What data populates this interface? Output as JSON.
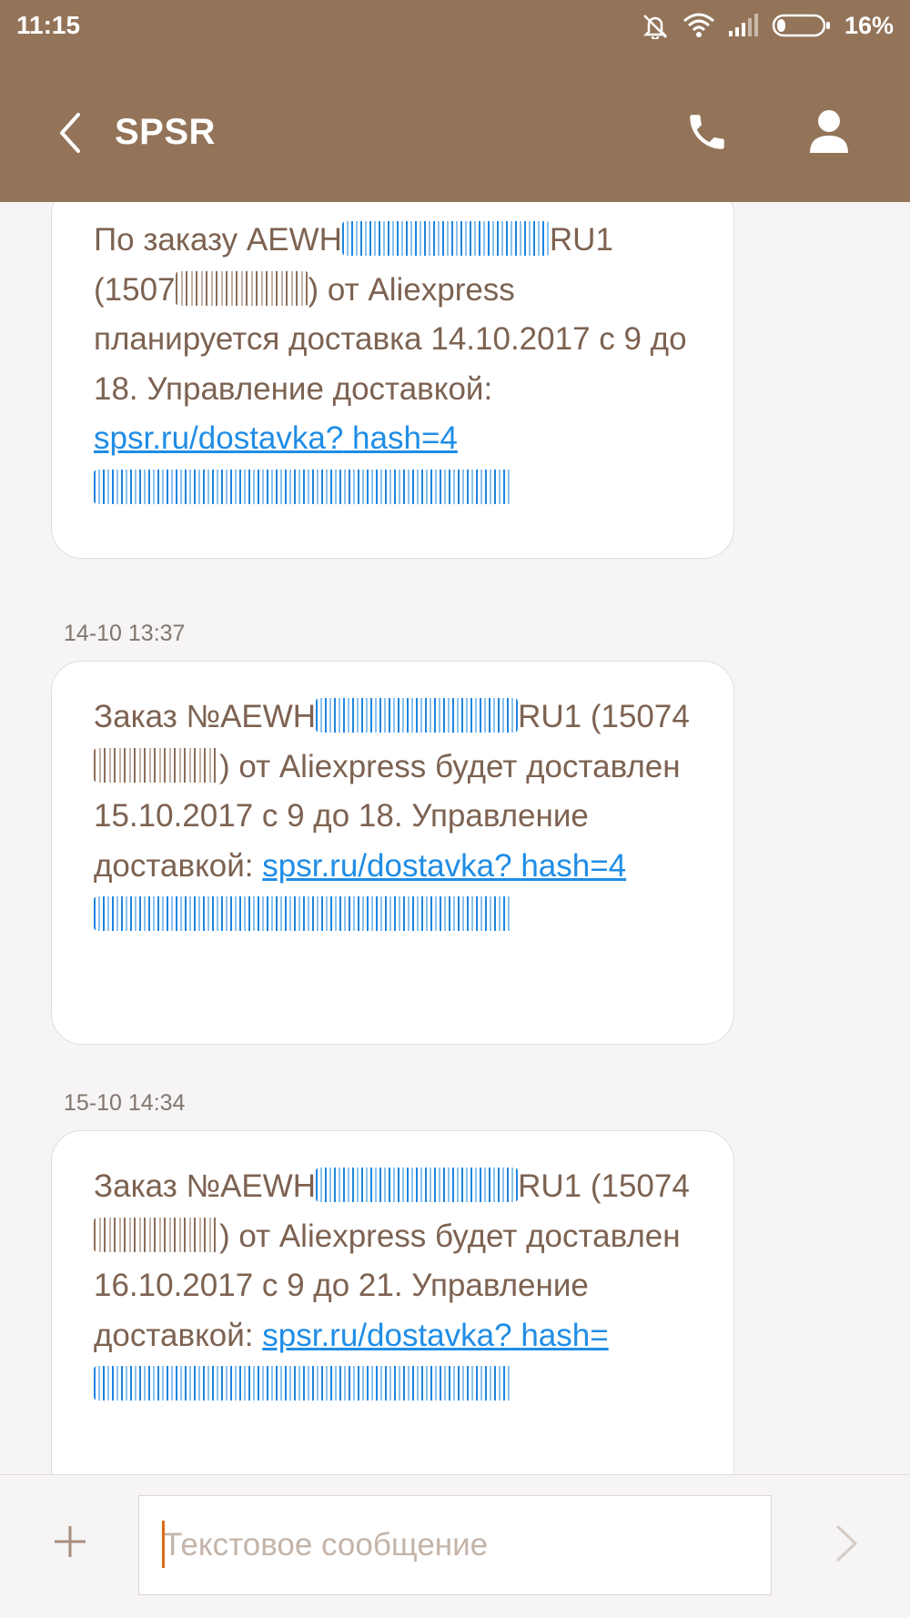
{
  "status": {
    "time": "11:15",
    "battery": "16%"
  },
  "header": {
    "title": "SPSR"
  },
  "messages": [
    {
      "timestamp": "",
      "text_a": "По заказу AEWH",
      "text_b": "RU1",
      "text_c": "(1507",
      "text_d": ") от Aliexpress планируется доставка 14.10.2017 с 9 до 18. Управление доставкой: ",
      "link_a": "spsr.ru/dostavka?",
      "link_b": "hash=4"
    },
    {
      "timestamp": "14-10 13:37",
      "text_a": "Заказ №AEWH",
      "text_b": "RU1",
      "text_c": "(15074",
      "text_d": ") от Aliexpress будет доставлен 15.10.2017 с 9 до 18. Управление доставкой: ",
      "link_a": "spsr.ru/dostavka?",
      "link_b": "hash=4"
    },
    {
      "timestamp": "15-10 14:34",
      "text_a": "Заказ №AEWH",
      "text_b": "RU1",
      "text_c": "(15074",
      "text_d": ") от Aliexpress будет доставлен 16.10.2017 с 9 до 21. Управление доставкой: ",
      "link_a": "spsr.ru/dostavka?",
      "link_b": "hash="
    }
  ],
  "composer": {
    "placeholder": "Текстовое сообщение"
  },
  "icons": {
    "status": [
      "mute-icon",
      "wifi-icon",
      "signal-icon",
      "battery-icon"
    ],
    "toolbar": [
      "back-arrow-icon",
      "phone-icon",
      "contact-icon"
    ],
    "composer": [
      "plus-icon",
      "send-icon"
    ]
  },
  "colors": {
    "appbar": "#937459",
    "message_text": "#7d6251",
    "link": "#1f8de6",
    "caret": "#e06a1a"
  }
}
